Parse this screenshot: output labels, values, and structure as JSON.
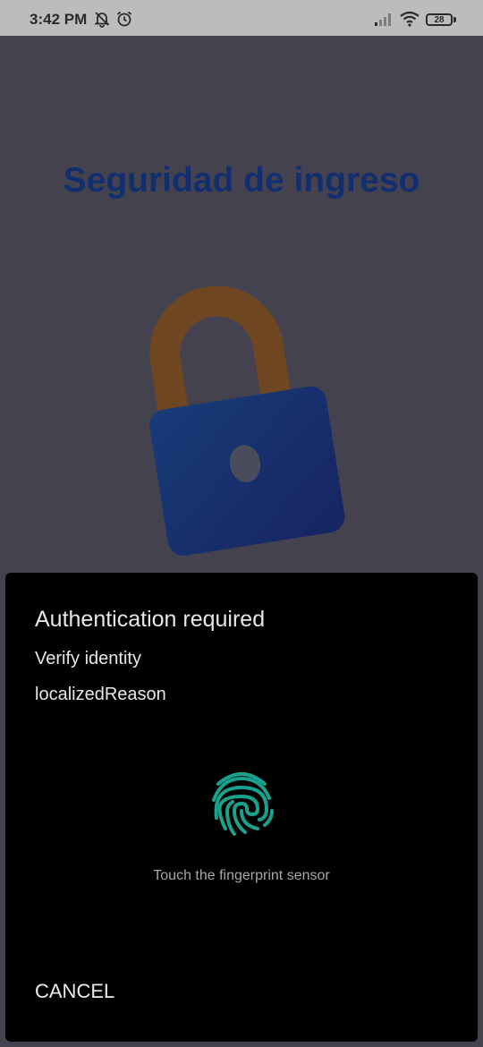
{
  "status_bar": {
    "time": "3:42 PM",
    "battery": "28",
    "icons": [
      "bell-off-icon",
      "alarm-icon",
      "signal-icon",
      "wifi-icon",
      "battery-icon"
    ]
  },
  "screen": {
    "title": "Seguridad de ingreso",
    "illustration": "padlock-icon"
  },
  "dialog": {
    "title": "Authentication required",
    "subtitle": "Verify identity",
    "description": "localizedReason",
    "fingerprint_icon": "fingerprint-icon",
    "fingerprint_hint": "Touch the fingerprint sensor",
    "cancel_label": "CANCEL"
  },
  "colors": {
    "overlay_background": "#44424f",
    "title_color": "#132e6e",
    "fingerprint_accent": "#1aa08b",
    "dialog_background": "#000000"
  }
}
